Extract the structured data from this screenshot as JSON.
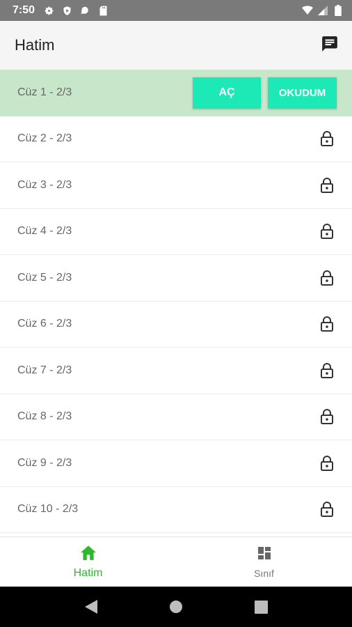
{
  "status_bar": {
    "time": "7:50",
    "background": "#7a7a7a",
    "left_icons": [
      "gear-icon",
      "shield-icon",
      "notification-icon",
      "sd-card-icon"
    ],
    "right_icons": [
      "wifi-icon",
      "signal-icon",
      "battery-icon"
    ]
  },
  "app_bar": {
    "title": "Hatim",
    "action_icon": "chat-icon"
  },
  "list": {
    "active_color": "#c8e6c9",
    "button_color": "#1de9b6",
    "items": [
      {
        "label": "Cüz 1 - 2/3",
        "state": "active",
        "open_label": "AÇ",
        "done_label": "OKUDUM"
      },
      {
        "label": "Cüz 2 - 2/3",
        "state": "locked"
      },
      {
        "label": "Cüz 3 - 2/3",
        "state": "locked"
      },
      {
        "label": "Cüz 4 - 2/3",
        "state": "locked"
      },
      {
        "label": "Cüz 5 - 2/3",
        "state": "locked"
      },
      {
        "label": "Cüz 6 - 2/3",
        "state": "locked"
      },
      {
        "label": "Cüz 7 - 2/3",
        "state": "locked"
      },
      {
        "label": "Cüz 8 - 2/3",
        "state": "locked"
      },
      {
        "label": "Cüz 9 - 2/3",
        "state": "locked"
      },
      {
        "label": "Cüz 10 - 2/3",
        "state": "locked"
      }
    ]
  },
  "bottom_nav": {
    "items": [
      {
        "label": "Hatim",
        "icon": "home-icon",
        "active": true
      },
      {
        "label": "Sınıf",
        "icon": "dashboard-icon",
        "active": false
      }
    ],
    "active_color": "#2eb82e"
  },
  "system_nav": {
    "buttons": [
      "back-icon",
      "home-circle-icon",
      "recents-icon"
    ]
  }
}
